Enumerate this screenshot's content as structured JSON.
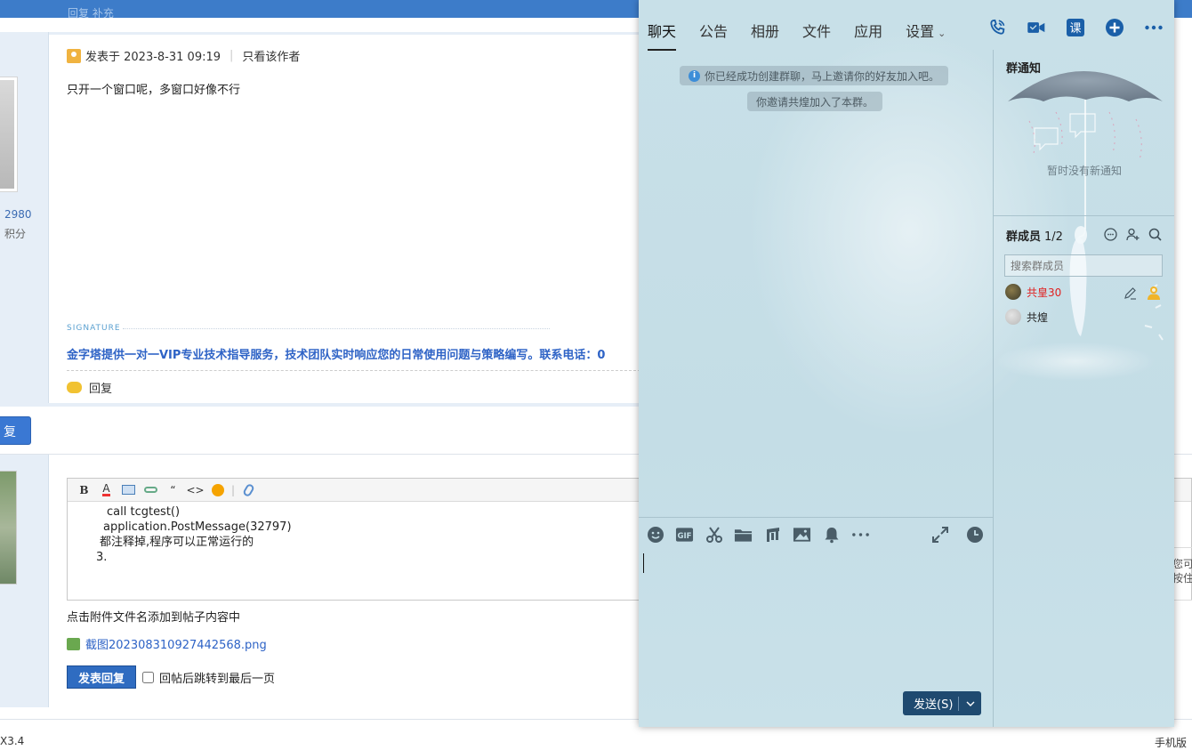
{
  "forum": {
    "top_ghost_text": "回复   补充",
    "user_points": "2980",
    "user_points_label": "积分",
    "post_meta": {
      "posted_at": "发表于 2023-8-31 09:19",
      "only_author": "只看该作者"
    },
    "post_body": "只开一个窗口呢，多窗口好像不行",
    "signature_label": "SIGNATURE",
    "signature_text": "金字塔提供一对一VIP专业技术指导服务，技术团队实时响应您的日常使用问题与策略编写。联系电话：0",
    "reply_link": "回复",
    "fast_reply_button": "复",
    "editor_lines": [
      "call tcgtest()",
      "application.PostMessage(32797)",
      "都注释掉,程序可以正常运行的",
      "3."
    ],
    "attach_hint": "点击附件文件名添加到帖子内容中",
    "attach_file": "截图202308310927442568.png",
    "submit_button": "发表回复",
    "jump_checkbox_label": "回帖后跳转到最后一页",
    "right_hint": "您可\n按住",
    "footer_left": "X3.4",
    "footer_right": "手机版"
  },
  "chat": {
    "tabs": [
      {
        "label": "聊天",
        "active": true
      },
      {
        "label": "公告"
      },
      {
        "label": "相册"
      },
      {
        "label": "文件"
      },
      {
        "label": "应用"
      },
      {
        "label": "设置"
      }
    ],
    "header_icons": [
      "phone-icon",
      "video-icon",
      "course-icon",
      "add-icon",
      "more-icon"
    ],
    "course_icon_text": "课",
    "system_messages": [
      "你已经成功创建群聊，马上邀请你的好友加入吧。",
      "你邀请共煌加入了本群。"
    ],
    "input_tools": [
      "emoji-icon",
      "gif-icon",
      "scissors-icon",
      "folder-icon",
      "music-icon",
      "image-icon",
      "bell-icon",
      "more-icon"
    ],
    "gif_label": "GIF",
    "send_button": "发送(S)",
    "side": {
      "notice_title": "群通知",
      "notice_empty": "暂时没有新通知",
      "members_title": "群成员",
      "members_count": "1/2",
      "search_placeholder": "搜索群成员",
      "members": [
        {
          "name": "共皇30",
          "role": "owner"
        },
        {
          "name": "共煌"
        }
      ]
    },
    "accent_color": "#1a5fa8",
    "owner_name_color": "#e02020"
  }
}
